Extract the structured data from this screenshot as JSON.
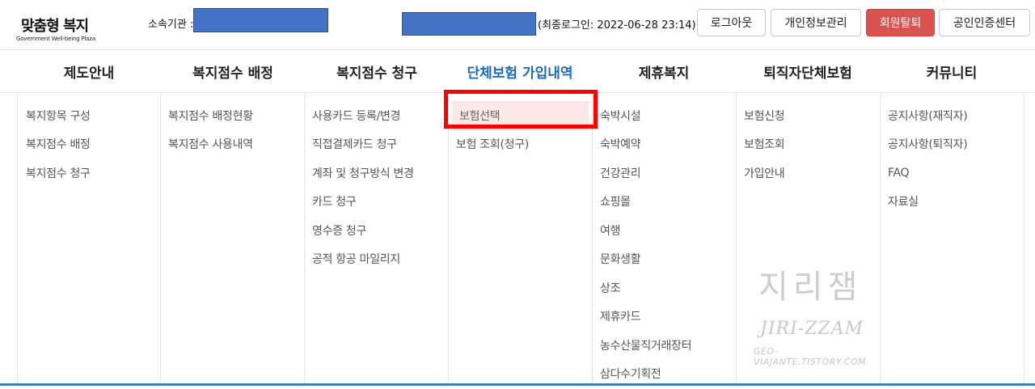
{
  "header": {
    "logo": {
      "korean_name": "맞춤형 복지",
      "english_tagline": "Government Well-being Plaza"
    },
    "affiliation_label": "소속기관 :",
    "last_login": "(최종로그인: 2022-06-28 23:14)",
    "buttons": {
      "logout": "로그아웃",
      "my_info": "개인정보관리",
      "withdraw": "회원탈퇴",
      "certificate": "공인인증센터"
    }
  },
  "colors": {
    "accent_blue": "#1a6bbf",
    "withdraw_red": "#d9534f",
    "highlight_red": "#ff0000",
    "redaction_blue": "#4472c4"
  },
  "nav": [
    {
      "label": "제도안내"
    },
    {
      "label": "복지점수 배정"
    },
    {
      "label": "복지점수 청구"
    },
    {
      "label": "단체보험 가입내역",
      "active": true
    },
    {
      "label": "제휴복지"
    },
    {
      "label": "퇴직자단체보험"
    },
    {
      "label": "커뮤니티"
    }
  ],
  "menu_columns": [
    {
      "items": [
        "복지항목 구성",
        "복지점수 배정",
        "복지점수 청구"
      ]
    },
    {
      "items": [
        "복지점수 배정현황",
        "복지점수 사용내역"
      ]
    },
    {
      "items": [
        "사용카드 등록/변경",
        "직접결제카드 청구",
        "계좌 및 청구방식 변경",
        "카드 청구",
        "영수증 청구",
        "공적 항공 마일리지"
      ]
    },
    {
      "items": [
        "보험선택",
        "보험 조회(청구)"
      ],
      "selected_index": 0
    },
    {
      "items": [
        "숙박시설",
        "숙박예약",
        "건강관리",
        "쇼핑몰",
        "여행",
        "문화생활",
        "상조",
        "제휴카드",
        "농수산물직거래장터",
        "삼다수기획전"
      ]
    },
    {
      "items": [
        "보험신청",
        "보험조회",
        "가입안내"
      ]
    },
    {
      "items": [
        "공지사항(재직자)",
        "공지사항(퇴직자)",
        "FAQ",
        "자료실"
      ]
    }
  ],
  "watermark": {
    "line1": "지리잼",
    "line2": "JIRI-ZZAM",
    "line3": "GEO-VIAJANTE.TISTORY.COM"
  }
}
